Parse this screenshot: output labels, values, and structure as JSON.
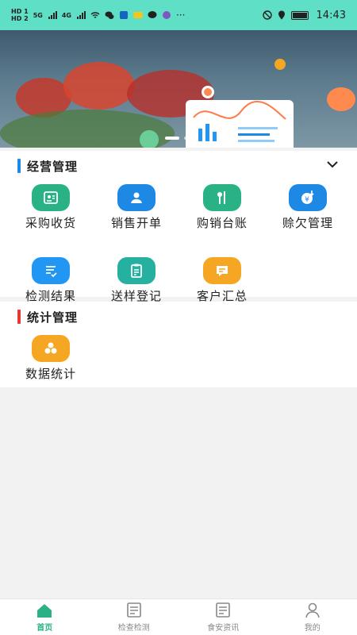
{
  "status_bar": {
    "sim1": "HD 1",
    "sim2": "HD 2",
    "net1": "5G",
    "net2": "4G",
    "time": "14:43"
  },
  "banner": {
    "alt": "market-vegetables"
  },
  "sections": [
    {
      "title": "经营管理",
      "accent": "#1e88e5",
      "items": [
        {
          "label": "采购收货",
          "color": "#2ab286",
          "icon": "receipt-icon"
        },
        {
          "label": "销售开单",
          "color": "#1e88e5",
          "icon": "person-icon"
        },
        {
          "label": "购销台账",
          "color": "#2ab286",
          "icon": "ledger-icon"
        },
        {
          "label": "赊欠管理",
          "color": "#1e88e5",
          "icon": "credit-icon"
        },
        {
          "label": "检测结果",
          "color": "#2196f3",
          "icon": "checklist-icon"
        },
        {
          "label": "送样登记",
          "color": "#26b0a0",
          "icon": "clipboard-icon"
        },
        {
          "label": "客户汇总",
          "color": "#f5a623",
          "icon": "summary-icon"
        }
      ]
    },
    {
      "title": "统计管理",
      "accent": "#e53935",
      "items": [
        {
          "label": "数据统计",
          "color": "#f5a623",
          "icon": "stats-icon"
        }
      ]
    }
  ],
  "tabbar": {
    "items": [
      {
        "label": "首页",
        "icon": "home-icon",
        "active": true
      },
      {
        "label": "检查检测",
        "icon": "inspection-icon",
        "active": false
      },
      {
        "label": "食安资讯",
        "icon": "news-icon",
        "active": false
      },
      {
        "label": "我的",
        "icon": "profile-icon",
        "active": false
      }
    ]
  },
  "colors": {
    "brand_green": "#2ab286",
    "status_bar": "#5fe0c6"
  }
}
